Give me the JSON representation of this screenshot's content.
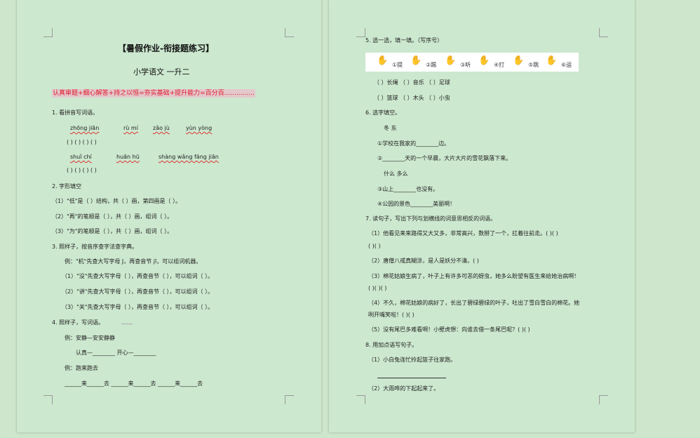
{
  "left": {
    "title": "【暑假作业-衔接题练习】",
    "subtitle": "小学语文  一升二",
    "motto": "认真审题+细心解答+持之以恒=夯实基础+提升能力=百分百...............",
    "q1_title": "1.    看拼音写词语。",
    "q1_py1": "zhōng jiān",
    "q1_py2": "rù mí",
    "q1_py3": "zǎo jù",
    "q1_py4": "yùn yòng",
    "q1_blanks1": "(             )    (             )    (             )    (             )",
    "q1_py5": "shuǐ chí",
    "q1_py6": "huān hū",
    "q1_py7": "shàng wǎng  fáng jiān",
    "q1_blanks2": "(             )    (             )    (             )    (             )",
    "q2_title": "2.    字形填空",
    "q2_l1": "（1）\"低\"是（      ）结构，共（      ）画，第四画是（      ）。",
    "q2_l2": "（2）\"再\"的笔顺是（      ），共（      ）画，组词（      ）。",
    "q2_l3": "（3）\"为\"的笔顺是（      ），共（      ）画，组词（      ）。",
    "q3_title": "3.    照样子，按音序查字法查字典。",
    "q3_ex": "例：\"机\"先查大写字母 J，再查音节 jī，可以组词机器。",
    "q3_l1": "（1）\"没\"先查大写字母（      ），再查音节（      ），可以组词（      ）。",
    "q3_l2": "（2）\"讲\"先查大写字母（      ），再查音节（      ），可以组词（      ）。",
    "q3_l3": "（3）\"关\"先查大写字母（      ），再查音节（      ），可以组词（      ）。",
    "q4_title": "4.    照样子，写词语。",
    "q4_ex1": "例：安静—安安静静",
    "q4_l1": "认真—________         开心—________",
    "q4_ex2": "例：跑来跑去",
    "q4_l2": "______来______去      ______来______去      ______来______去"
  },
  "right": {
    "q5_title": "5.    选一选，填一填。（写序号）",
    "q5_items": [
      "①提",
      "②踢",
      "③听",
      "④打",
      "⑤跳",
      "⑥运"
    ],
    "q5_r1": "（      ）长绳              （      ）音乐              （      ）足球",
    "q5_r2": "（      ）篮球              （      ）木头              （      ）小虫",
    "q6_title": "6.    选字填空。",
    "q6_pair1": "冬      东",
    "q6_s1": "①学校在我家的________边。",
    "q6_s2": "②________天的一个早晨，大片大片的雪花飘落下来。",
    "q6_pair2": "什么      多么",
    "q6_s3": "③山上________也没有。",
    "q6_s4": "④公园的景色________美丽啊！",
    "q7_title": "7.    读句子，写出下列与划横线的词意思相反的词语。",
    "q7_l1": "（1）他看见来来路得又大又多，非常高兴，数掰了一个，扛着往前走。(          )(          )",
    "q7_l1b": "(          )(          )",
    "q7_l2": "（2）唐僧八戒真糊涂，是人是妖分不清。(          )",
    "q7_l3": "（3）棉花姑娘生病了，叶子上有许多可恶的蚜虫，她多么盼望有医生来给她治病啊！",
    "q7_l3b": "(          )(          )(          )",
    "q7_l4": "（4）不久，棉花姑娘的病好了，长出了碧绿碧绿的叶子，吐出了雪白雪白的棉花。她",
    "q7_l4b": "咧开嘴笑啦！(          )(          )",
    "q7_l5": "（5）没有尾巴多难看啊！小壁虎想：向谁去借一条尾巴呢？(          )(          )",
    "q8_title": "8.    用加点语写句子。",
    "q8_l1": "（1）小白兔连忙拎起篮子往家跑。",
    "q8_l2": "（2）大雨哗的下起起来了。"
  }
}
